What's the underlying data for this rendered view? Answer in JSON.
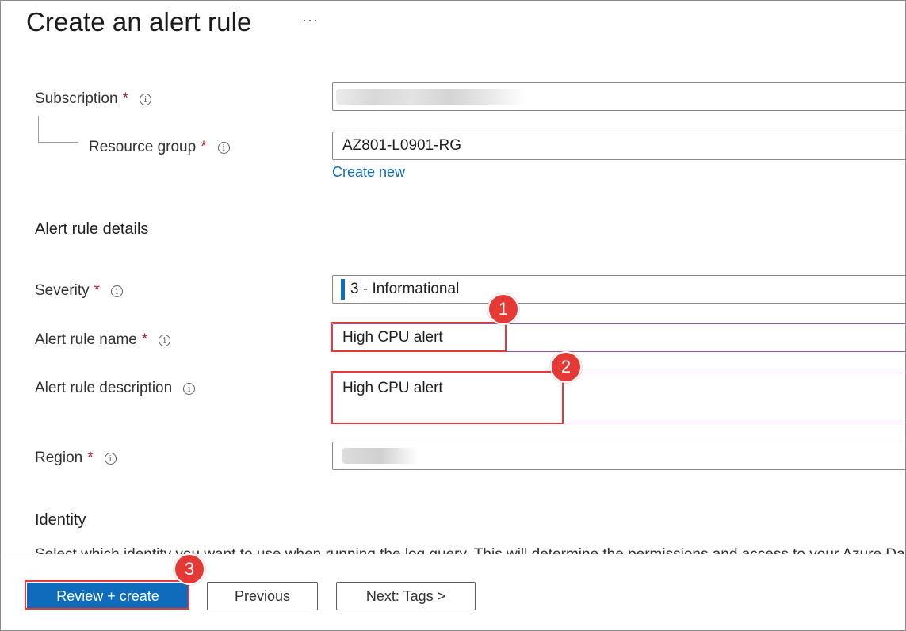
{
  "page": {
    "title": "Create an alert rule",
    "more_label": "···"
  },
  "scope": {
    "subscription_label": "Subscription",
    "resource_group_label": "Resource group",
    "resource_group_value": "AZ801-L0901-RG",
    "create_new_link": "Create new"
  },
  "details": {
    "section_title": "Alert rule details",
    "severity_label": "Severity",
    "severity_value": "3 - Informational",
    "name_label": "Alert rule name",
    "name_value": "High CPU alert",
    "description_label": "Alert rule description",
    "description_value": "High CPU alert",
    "region_label": "Region"
  },
  "identity": {
    "section_title": "Identity",
    "truncated_text": "Select which identity you want to use when running the log query. This will determine the permissions and access to your Azure Data Explorer"
  },
  "footer": {
    "review_create_label": "Review + create",
    "previous_label": "Previous",
    "next_label": "Next: Tags >"
  },
  "annotations": {
    "badge_1": "1",
    "badge_2": "2",
    "badge_3": "3"
  },
  "common": {
    "required_mark": "*",
    "info_glyph": "i"
  },
  "colors": {
    "accent": "#0f6cbd",
    "highlight": "#e53935",
    "required": "#a4262c"
  }
}
